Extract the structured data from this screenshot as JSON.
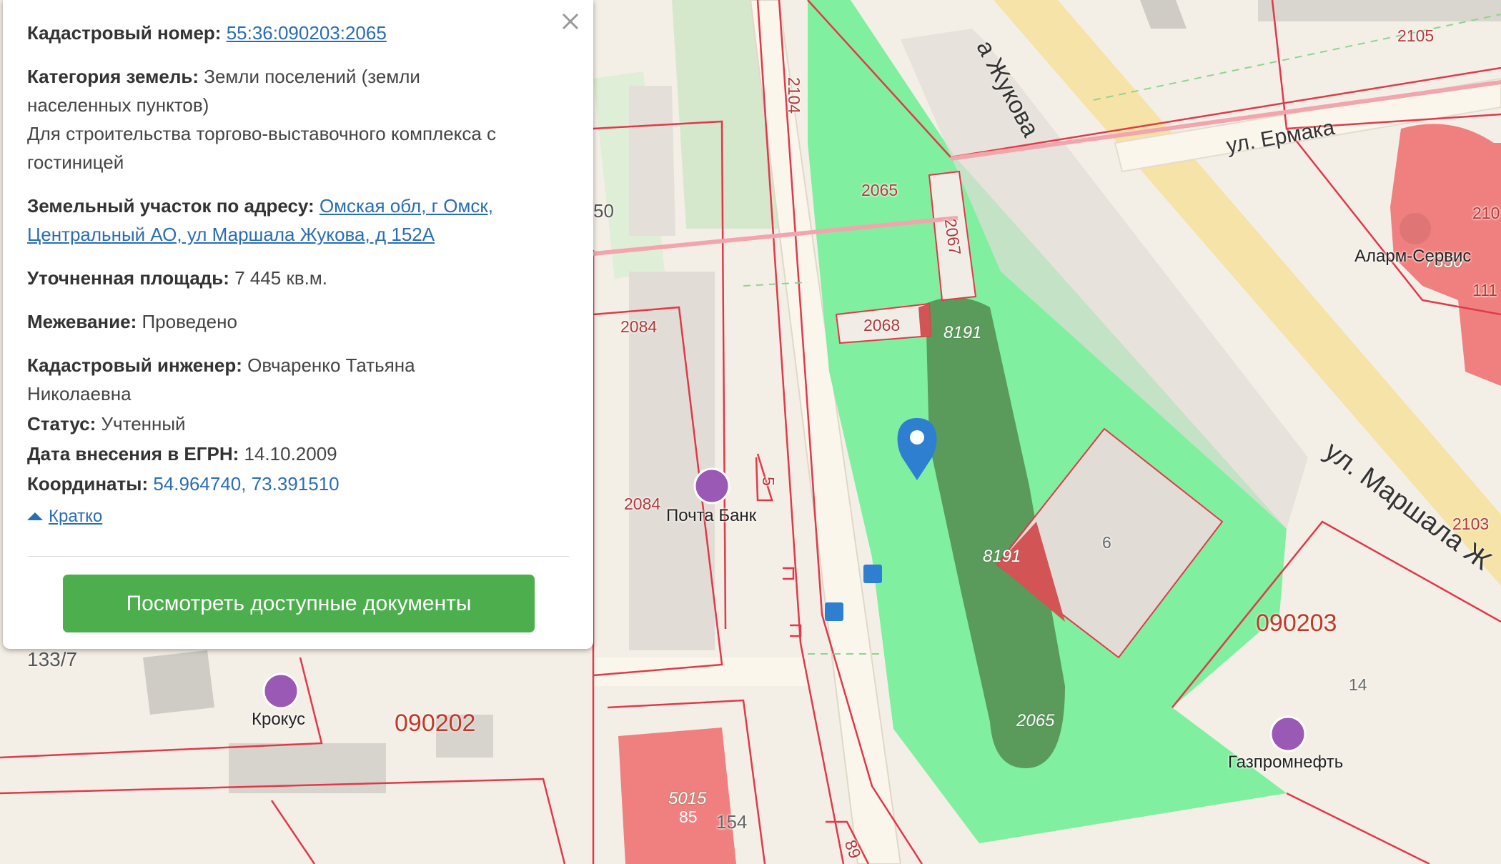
{
  "panel": {
    "cadastral_number_label": "Кадастровый номер:",
    "cadastral_number": "55:36:090203:2065",
    "land_category_label": "Категория земель:",
    "land_category_line1": "Земли поселений (земли",
    "land_category_line2": "населенных пунктов)",
    "usage_line1": "Для строительства торгово-выставочного комплекса с",
    "usage_line2": "гостиницей",
    "address_label": "Земельный участок по адресу:",
    "address_line1": "Омская обл, г Омск,",
    "address_line2": "Центральный АО, ул Маршала Жукова, д 152А",
    "area_label": "Уточненная площадь:",
    "area_value": "7 445 кв.м.",
    "survey_label": "Межевание:",
    "survey_value": "Проведено",
    "engineer_label": "Кадастровый инженер:",
    "engineer_line1": "Овчаренко Татьяна",
    "engineer_line2": "Николаевна",
    "status_label": "Статус:",
    "status_value": "Учтенный",
    "egrn_date_label": "Дата внесения в ЕГРН:",
    "egrn_date_value": "14.10.2009",
    "coords_label": "Координаты:",
    "coords_value": "54.964740, 73.391510",
    "toggle_label": "Кратко",
    "docs_button": "Посмотреть доступные документы",
    "close_icon": "close-icon"
  },
  "map": {
    "streets": {
      "zhukova_top": "а Жукова",
      "ermaka": "ул. Ермака",
      "marshala": "ул. Маршала Ж"
    },
    "quarters": {
      "q1": "090203",
      "q2": "090202"
    },
    "parcel_numbers": {
      "n2105": "2105",
      "n2104": "2104",
      "n2065a": "2065",
      "n2067": "2067",
      "n2068": "2068",
      "n2084a": "2084",
      "n2084b": "2084",
      "n50": "50",
      "n5": "5",
      "n2103": "2103",
      "n210": "210",
      "n111": "111",
      "n6": "6",
      "n14": "14",
      "n133_7": "133/7",
      "n85": "85",
      "n154": "154",
      "n89": "89"
    },
    "parcel_italic": {
      "p8191a": "8191",
      "p8191b": "8191",
      "p2065b": "2065",
      "p5015": "5015",
      "p7850": "7850"
    },
    "pois": {
      "pochta": "Почта Банк",
      "krokus": "Крокус",
      "gazprom": "Газпромнефть",
      "alarm": "Аларм-Сервис"
    },
    "colors": {
      "selected_parcel": "#79ee9c",
      "building_dark": "#5a9a5a",
      "boundary": "#e0394a",
      "red_parcel": "#f08080",
      "road_yellow": "#f5e3a8",
      "button_green": "#4cae4c",
      "marker_blue": "#2f7fd0"
    }
  }
}
